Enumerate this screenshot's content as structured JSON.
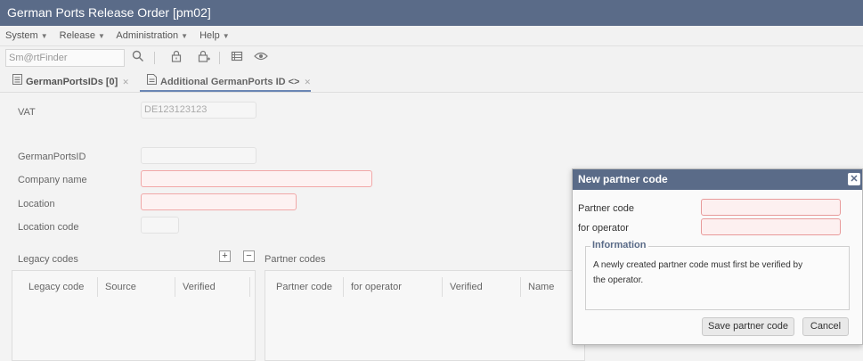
{
  "window": {
    "title": "German Ports Release Order [pm02]"
  },
  "menu": {
    "items": [
      {
        "label": "System"
      },
      {
        "label": "Release"
      },
      {
        "label": "Administration"
      },
      {
        "label": "Help"
      }
    ]
  },
  "toolbar": {
    "finder_placeholder": "Sm@rtFinder"
  },
  "tabs": [
    {
      "label": "GermanPortsIDs [0]"
    },
    {
      "label": "Additional GermanPorts ID <>"
    }
  ],
  "form": {
    "vat_label": "VAT",
    "vat_value": "DE123123123",
    "germanportsid_label": "GermanPortsID",
    "company_name_label": "Company name",
    "location_label": "Location",
    "location_code_label": "Location code"
  },
  "legacy_codes": {
    "title": "Legacy codes",
    "columns": [
      "Legacy code",
      "Source",
      "Verified"
    ]
  },
  "partner_codes": {
    "title": "Partner codes",
    "columns": [
      "Partner code",
      "for operator",
      "Verified",
      "Name"
    ]
  },
  "dialog": {
    "title": "New partner code",
    "partner_code_label": "Partner code",
    "for_operator_label": "for operator",
    "info_title": "Information",
    "info_text": "A newly created partner code must first be verified by the operator.",
    "save_label": "Save partner code",
    "cancel_label": "Cancel"
  }
}
